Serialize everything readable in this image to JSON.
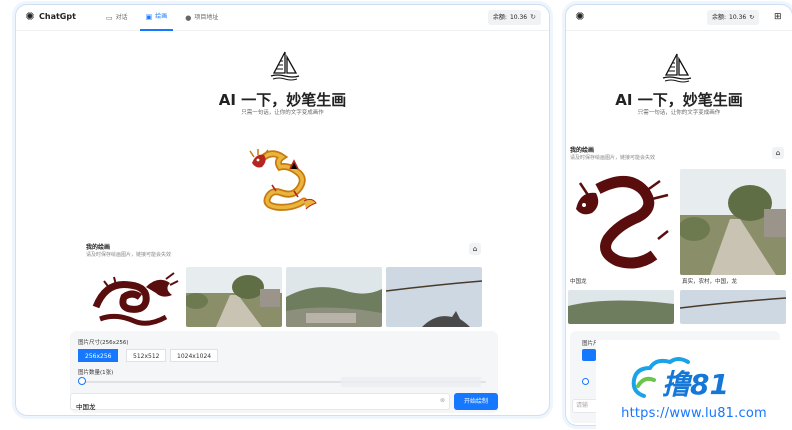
{
  "desktop": {
    "brand": "ChatGpt",
    "tabs": [
      {
        "label": "对话",
        "icon": "chat-icon"
      },
      {
        "label": "绘画",
        "icon": "image-icon",
        "active": true
      },
      {
        "label": "项目地址",
        "icon": "github-icon"
      }
    ],
    "balance_label": "余额:",
    "balance_value": "10.36",
    "hero_title": "AI 一下，妙笔生画",
    "hero_sub": "只需一句话，让你的文字变成画作",
    "my_drawings_title": "我的绘画",
    "my_drawings_sub": "请及时保存绘画图片，链接可能会失效",
    "panel": {
      "size_label": "图片尺寸(256x256)",
      "sizes": [
        "256x256",
        "512x512",
        "1024x1024"
      ],
      "selected_size": "256x256",
      "count_label": "图片数量(1张)",
      "count_value": 0.0,
      "prompt_value": "中国龙",
      "submit_label": "开始绘制"
    }
  },
  "mobile": {
    "balance_label": "余额:",
    "balance_value": "10.36",
    "hero_title": "AI 一下，妙笔生画",
    "hero_sub": "只需一句话，让你的文字变成画作",
    "my_drawings_title": "我的绘画",
    "my_drawings_sub": "请及时保存绘画图片，链接可能会失效",
    "captions": [
      "中国龙",
      "真实，农村，中国，龙"
    ],
    "panel_label": "图片尺寸(256x256)",
    "prompt_placeholder": "请输"
  },
  "watermark": {
    "logo_text": "撸81",
    "url": "https://www.lu81.com"
  },
  "colors": {
    "accent": "#1677ff",
    "dragon_red": "#5a0d0d",
    "dragon_gold": "#d4931f"
  }
}
